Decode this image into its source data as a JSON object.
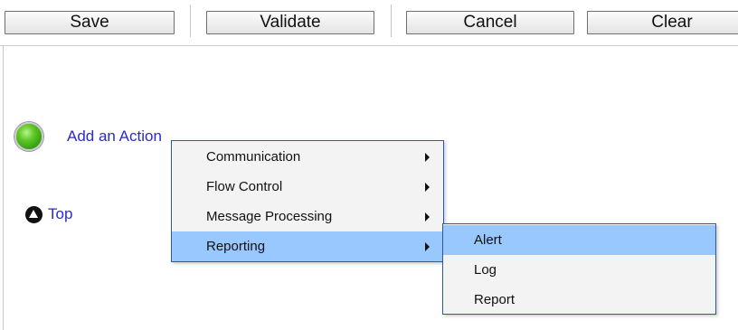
{
  "toolbar": {
    "save_label": "Save",
    "validate_label": "Validate",
    "cancel_label": "Cancel",
    "clear_label": "Clear"
  },
  "status": {
    "color": "#3fb31c",
    "state": "ok"
  },
  "actions": {
    "add_label": "Add an Action"
  },
  "nav": {
    "top_label": "Top"
  },
  "context_menu": {
    "items": [
      {
        "label": "Communication",
        "has_submenu": true
      },
      {
        "label": "Flow Control",
        "has_submenu": true
      },
      {
        "label": "Message Processing",
        "has_submenu": true
      },
      {
        "label": "Reporting",
        "has_submenu": true,
        "highlighted": true
      }
    ]
  },
  "submenu": {
    "parent": "Reporting",
    "items": [
      {
        "label": "Alert",
        "highlighted": true
      },
      {
        "label": "Log"
      },
      {
        "label": "Report"
      }
    ]
  },
  "colors": {
    "link": "#2a2ad0",
    "menu_highlight": "#99c8ff",
    "menu_border": "#2b56b5"
  }
}
